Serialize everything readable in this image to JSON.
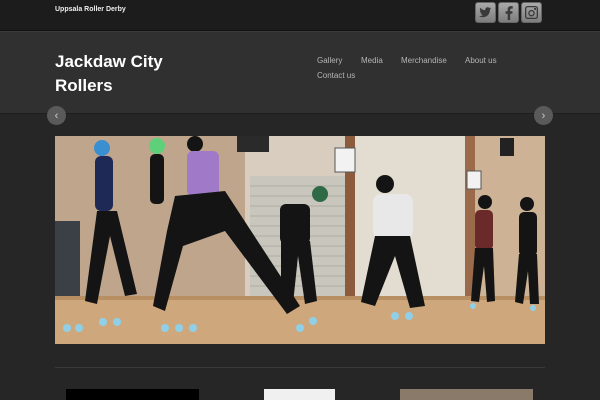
{
  "topbar": {
    "tagline": "Uppsala Roller Derby",
    "social": [
      {
        "name": "twitter-icon",
        "glyph": "🐦"
      },
      {
        "name": "facebook-icon",
        "glyph": "f"
      },
      {
        "name": "instagram-icon",
        "glyph": "◙"
      }
    ]
  },
  "header": {
    "title_line1": "Jackdaw City",
    "title_line2": "Rollers"
  },
  "nav": {
    "items": [
      "Gallery",
      "Media",
      "Merchandise",
      "About us",
      "Contact us"
    ]
  },
  "slider": {
    "prev_glyph": "‹",
    "next_glyph": "›",
    "image_description": "roller-derby-practice-photo"
  },
  "colors": {
    "background": "#262626",
    "header": "#303030",
    "topbar": "#1c1c1c",
    "title": "#ffffff",
    "nav": "#b5b5b5"
  }
}
